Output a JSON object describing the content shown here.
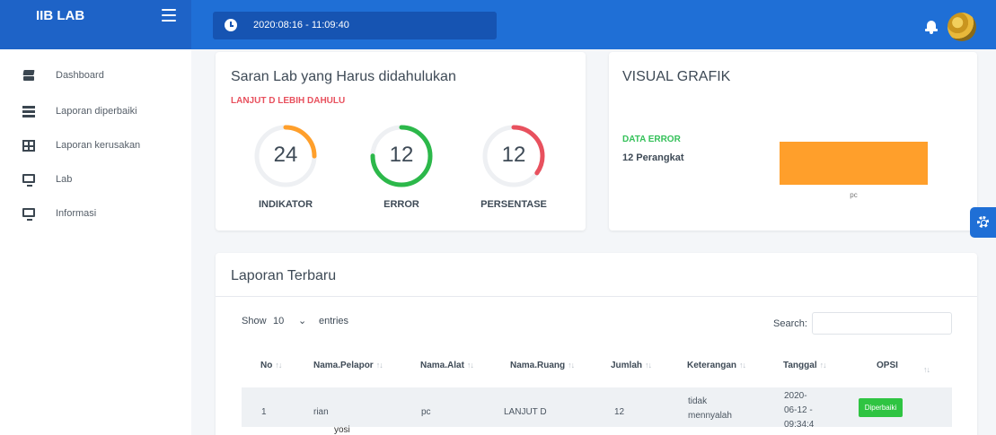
{
  "brand": {
    "title": "IIB LAB"
  },
  "header": {
    "datetime": "2020:08:16 - 11:09:40"
  },
  "sidebar": {
    "items": [
      {
        "label": "Dashboard",
        "icon": "layers-icon"
      },
      {
        "label": "Laporan diperbaiki",
        "icon": "list-icon"
      },
      {
        "label": "Laporan kerusakan",
        "icon": "table-icon"
      },
      {
        "label": "Lab",
        "icon": "monitor-icon"
      },
      {
        "label": "Informasi",
        "icon": "monitor-icon"
      }
    ]
  },
  "suggestion_card": {
    "title": "Saran Lab yang Harus didahulukan",
    "alert": "LANJUT D LEBIH DAHULU",
    "gauges": [
      {
        "value": "24",
        "label": "INDIKATOR",
        "color": "#ff9f2b",
        "fraction": 0.25
      },
      {
        "value": "12",
        "label": "ERROR",
        "color": "#2cb84a",
        "fraction": 0.75
      },
      {
        "value": "12",
        "label": "PERSENTASE",
        "color": "#e8515e",
        "fraction": 0.35
      }
    ]
  },
  "chart_card": {
    "title": "VISUAL GRAFIK",
    "data_label": "DATA ERROR",
    "device_count": "12 Perangkat"
  },
  "chart_data": {
    "type": "bar",
    "categories": [
      "pc"
    ],
    "values": [
      12
    ],
    "title": "",
    "xlabel": "",
    "ylabel": "",
    "ylim": [
      0,
      12
    ],
    "color": "#ff9f2b"
  },
  "report_card": {
    "title": "Laporan Terbaru",
    "show_label": "Show",
    "entries_value": "10",
    "entries_label": "entries",
    "search_label": "Search:",
    "search_value": "",
    "columns": [
      "No",
      "Nama.Pelapor",
      "Nama.Alat",
      "Nama.Ruang",
      "Jumlah",
      "Keterangan",
      "Tanggal",
      "OPSI"
    ],
    "rows": [
      {
        "no": "1",
        "pelapor": "rian",
        "alat": "pc",
        "ruang": "LANJUT D",
        "jumlah": "12",
        "keterangan_l1": "tidak",
        "keterangan_l2": "mennyalah",
        "tanggal_l1": "2020-",
        "tanggal_l2": "06-12 -",
        "tanggal_l3": "09:34:4",
        "status": "Diperbaiki"
      }
    ],
    "next_row_partial": "yosi"
  },
  "colors": {
    "primary": "#1f6fd6",
    "success": "#2fc442",
    "danger": "#e8515e",
    "warning": "#ff9f2b"
  }
}
